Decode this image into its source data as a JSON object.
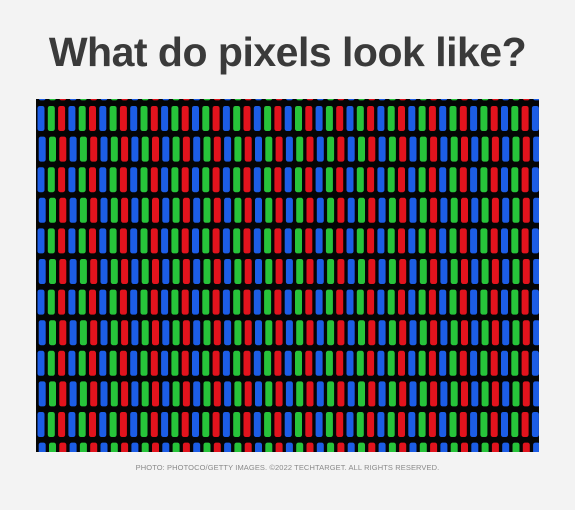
{
  "title": "What do pixels look like?",
  "credit": "PHOTO: PHOTOCO/GETTY IMAGES. ©2022 TECHTARGET. ALL RIGHTS RESERVED.",
  "image": {
    "subject": "close-up of RGB display subpixels",
    "colors": {
      "background": "#050505",
      "red": "#e2131d",
      "green": "#27c43a",
      "blue": "#1c5de6"
    }
  }
}
